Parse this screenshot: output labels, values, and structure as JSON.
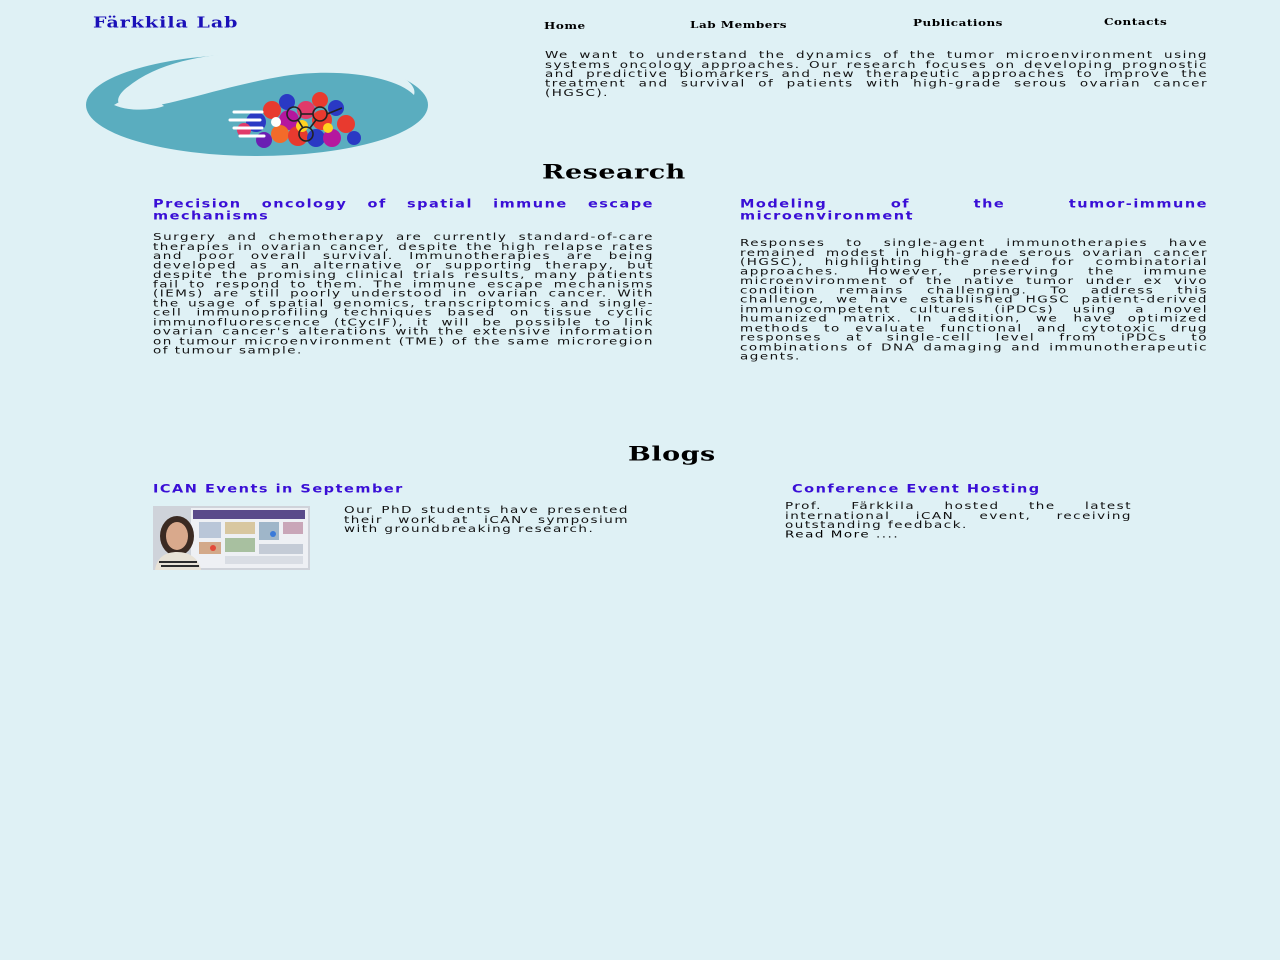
{
  "header": {
    "brand": "Färkkila Lab",
    "nav": [
      "Home",
      "Lab Members",
      "Publications",
      "Contacts"
    ]
  },
  "intro": {
    "text": "We want to understand the dynamics of the tumor microenvironment using systems oncology approaches. Our research focuses on developing prognostic and predictive biomarkers and new therapeutic approaches to improve the treatment and survival of patients with high-grade serous ovarian cancer (HGSC)."
  },
  "research": {
    "heading": "Research",
    "columns": [
      {
        "title": "Precision oncology of spatial immune escape mechanisms",
        "text": "Surgery and chemotherapy are currently standard-of-care therapies in ovarian cancer, despite the high relapse rates and poor overall survival. Immunotherapies are being developed as an alternative or supporting therapy, but despite the promising clinical trials results, many patients fail to respond to them. The immune escape mechanisms (IEMs) are still poorly understood in ovarian cancer. With the usage of spatial genomics, transcriptomics and single-cell immunoprofiling techniques based on tissue cyclic immunofluorescence (tCycIF), it will be possible to link ovarian cancer's alterations with the extensive information on tumour microenvironment (TME) of the same microregion of tumour sample."
      },
      {
        "title": "Modeling of the tumor-immune microenvironment",
        "text": "Responses to single-agent immunotherapies have remained modest in high-grade serous ovarian cancer (HGSC), highlighting the need for combinatorial approaches. However, preserving the immune microenvironment of the native tumor under ex vivo condition remains challenging. To address this challenge, we have established HGSC patient-derived immunocompetent cultures (iPDCs) using a novel humanized matrix. In addition, we have optimized methods to evaluate functional and cytotoxic drug responses at single-cell level from iPDCs to combinations of DNA damaging and immunotherapeutic agents."
      }
    ]
  },
  "blogs": {
    "heading": "Blogs",
    "items": [
      {
        "title": "ICAN Events in September",
        "text": "Our PhD students have presented their work at iCAN symposium with groundbreaking research."
      },
      {
        "title": "Conference Event Hosting",
        "text": "Prof. Färkkila hosted the latest international iCAN event, receiving outstanding feedback.",
        "read_more": "Read More ...."
      }
    ]
  },
  "colors": {
    "background": "#dff1f5",
    "brand": "#1a10b8",
    "accent_title": "#3a0fd6",
    "logo_teal": "#5aadbf"
  }
}
